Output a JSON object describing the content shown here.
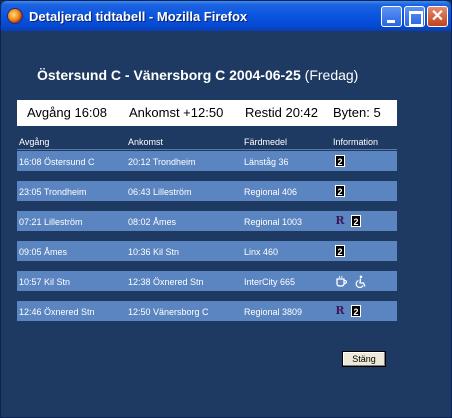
{
  "window": {
    "title": "Detaljerad tidtabell - Mozilla Firefox"
  },
  "heading": {
    "route": "Östersund C - Vänersborg C 2004-06-25",
    "day": "(Fredag)"
  },
  "summary": {
    "departure": "Avgång 16:08",
    "arrival": "Ankomst +12:50",
    "travel_time": "Restid 20:42",
    "changes": "Byten: 5"
  },
  "columns": {
    "departure": "Avgång",
    "arrival": "Ankomst",
    "transport": "Färdmedel",
    "information": "Information"
  },
  "rows": [
    {
      "departure": "16:08 Östersund C",
      "arrival": "20:12 Trondheim",
      "transport": "Länståg 36",
      "info": [
        "2"
      ]
    },
    {
      "departure": "23:05 Trondheim",
      "arrival": "06:43 Lilleström",
      "transport": "Regional 406",
      "info": [
        "2"
      ]
    },
    {
      "departure": "07:21 Lilleström",
      "arrival": "08:02 Åmes",
      "transport": "Regional 1003",
      "info": [
        "R",
        "2"
      ]
    },
    {
      "departure": "09:05 Åmes",
      "arrival": "10:36 Kil Stn",
      "transport": "Linx 460",
      "info": [
        "2"
      ]
    },
    {
      "departure": "10:57 Kil Stn",
      "arrival": "12:38 Öxnered Stn",
      "transport": "InterCity 665",
      "info": [
        "cup",
        "wheelchair"
      ]
    },
    {
      "departure": "12:46 Öxnered Stn",
      "arrival": "12:50 Vänersborg C",
      "transport": "Regional 3809",
      "info": [
        "R",
        "2"
      ]
    }
  ],
  "icons": {
    "reservation": "R",
    "second_class": "2",
    "cafe": "cup-icon",
    "accessible": "wheelchair-icon"
  },
  "buttons": {
    "close": "Stäng"
  }
}
